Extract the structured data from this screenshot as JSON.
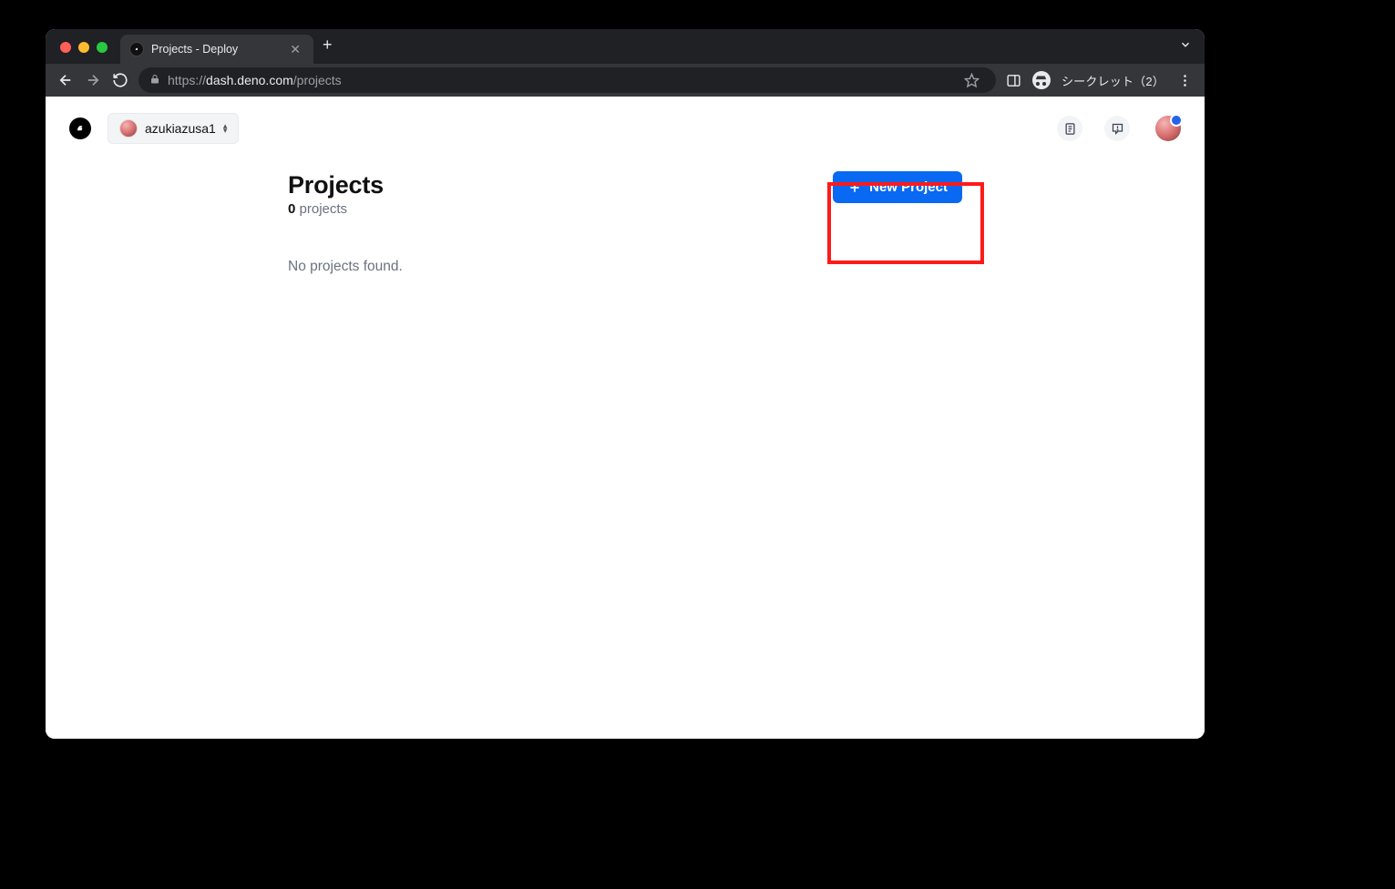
{
  "browser": {
    "tab_title": "Projects - Deploy",
    "url_scheme": "https://",
    "url_host": "dash.deno.com",
    "url_path": "/projects",
    "incognito_label": "シークレット（2）"
  },
  "header": {
    "org_name": "azukiazusa1"
  },
  "main": {
    "title": "Projects",
    "count_value": "0",
    "count_label": " projects",
    "new_project_label": "New Project",
    "empty_message": "No projects found."
  }
}
